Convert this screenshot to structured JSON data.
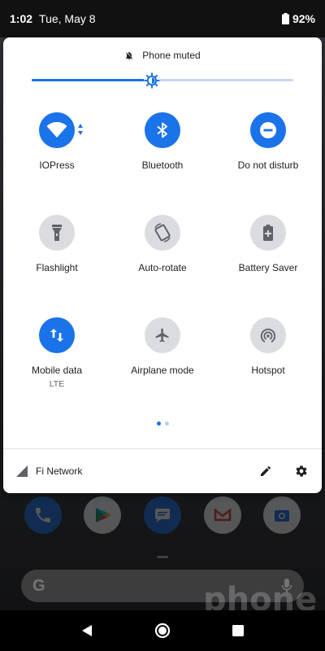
{
  "status_bar": {
    "time": "1:02",
    "date": "Tue, May 8",
    "battery": "92%"
  },
  "quick_settings": {
    "mute_text": "Phone muted",
    "brightness_level_pct": 46,
    "tiles": [
      {
        "id": "wifi",
        "label": "IOPress",
        "sublabel": "",
        "state": "on",
        "icon": "wifi-icon"
      },
      {
        "id": "bluetooth",
        "label": "Bluetooth",
        "sublabel": "",
        "state": "on",
        "icon": "bluetooth-icon"
      },
      {
        "id": "dnd",
        "label": "Do not disturb",
        "sublabel": "",
        "state": "on",
        "icon": "do-not-disturb-icon"
      },
      {
        "id": "flashlight",
        "label": "Flashlight",
        "sublabel": "",
        "state": "off",
        "icon": "flashlight-icon"
      },
      {
        "id": "autorotate",
        "label": "Auto-rotate",
        "sublabel": "",
        "state": "off",
        "icon": "auto-rotate-icon"
      },
      {
        "id": "battery_saver",
        "label": "Battery Saver",
        "sublabel": "",
        "state": "off",
        "icon": "battery-saver-icon"
      },
      {
        "id": "mobile_data",
        "label": "Mobile data",
        "sublabel": "LTE",
        "state": "on",
        "icon": "mobile-data-icon"
      },
      {
        "id": "airplane",
        "label": "Airplane mode",
        "sublabel": "",
        "state": "off",
        "icon": "airplane-icon"
      },
      {
        "id": "hotspot",
        "label": "Hotspot",
        "sublabel": "",
        "state": "off",
        "icon": "hotspot-icon"
      }
    ],
    "page_indicator": {
      "current": 1,
      "total": 2
    },
    "footer": {
      "network_name": "Fi Network",
      "edit_icon": "pencil-icon",
      "settings_icon": "gear-icon"
    }
  },
  "home": {
    "dock_apps": [
      "phone-app-icon",
      "play-store-app-icon",
      "messages-app-icon",
      "gmail-app-icon",
      "camera-app-icon"
    ],
    "search_bar_logo": "G"
  },
  "colors": {
    "accent": "#1a73e8",
    "tile_off": "#dadce0",
    "panel_bg": "#ffffff"
  }
}
